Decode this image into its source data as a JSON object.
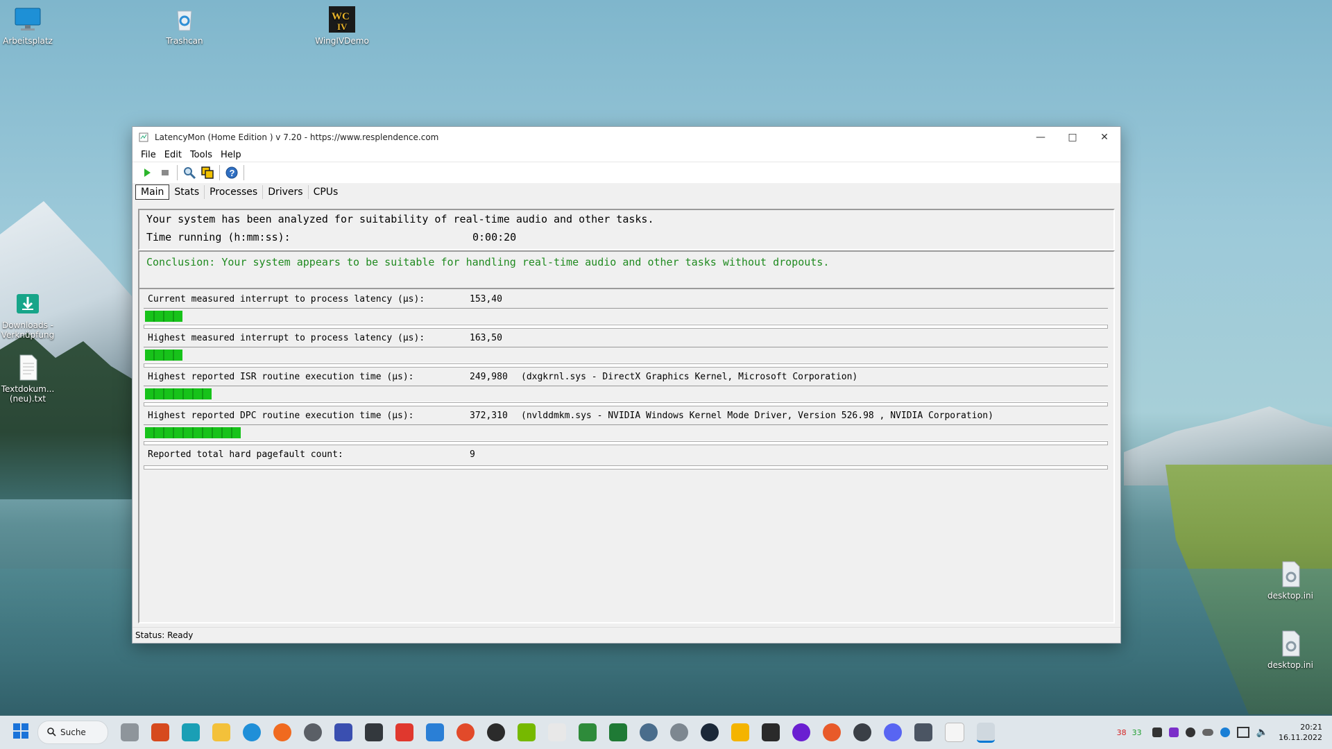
{
  "desktop": {
    "icons": [
      {
        "label": "Arbeitsplatz"
      },
      {
        "label": "Trashcan"
      },
      {
        "label": "WingIVDemo"
      },
      {
        "label": "Downloads - Verknüpfung"
      },
      {
        "label": "Textdokum... (neu).txt"
      },
      {
        "label": "desktop.ini"
      },
      {
        "label": "desktop.ini"
      }
    ]
  },
  "window": {
    "title": "LatencyMon  (Home Edition )  v 7.20 - https://www.resplendence.com",
    "menu": [
      "File",
      "Edit",
      "Tools",
      "Help"
    ],
    "toolbar_icons": [
      "play-icon",
      "stop-icon",
      "analyze-icon",
      "copy-icon",
      "help-icon"
    ],
    "tabs": [
      "Main",
      "Stats",
      "Processes",
      "Drivers",
      "CPUs"
    ],
    "active_tab": "Main",
    "summary": {
      "line1": "Your system has been analyzed for suitability of real-time audio and other tasks.",
      "time_label": "Time running (h:mm:ss):",
      "time_value": "0:00:20"
    },
    "conclusion": "Conclusion: Your system appears to be suitable for handling real-time audio and other tasks without dropouts.",
    "metrics": [
      {
        "label": "Current measured interrupt to process latency (µs):",
        "value": "153,40",
        "extra": "",
        "bar_fraction": 0.045
      },
      {
        "label": "Highest measured interrupt to process latency (µs):",
        "value": "163,50",
        "extra": "",
        "bar_fraction": 0.045
      },
      {
        "label": "Highest reported ISR routine execution time (µs):",
        "value": "249,980",
        "extra": "(dxgkrnl.sys - DirectX Graphics Kernel, Microsoft Corporation)",
        "bar_fraction": 0.068
      },
      {
        "label": "Highest reported DPC routine execution time (µs):",
        "value": "372,310",
        "extra": "(nvlddmkm.sys - NVIDIA Windows Kernel Mode Driver, Version 526.98 , NVIDIA Corporation)",
        "bar_fraction": 0.103
      },
      {
        "label": "Reported total hard pagefault count:",
        "value": "9",
        "extra": ""
      }
    ],
    "status": "Status: Ready"
  },
  "taskbar": {
    "search_label": "Suche",
    "tray_numbers": [
      "38",
      "33"
    ],
    "time": "20:21",
    "date": "16.11.2022",
    "colors": {
      "accent": "#0078d4",
      "bar_green": "#17c21a",
      "conclusion_green": "#1f8a1f"
    }
  }
}
